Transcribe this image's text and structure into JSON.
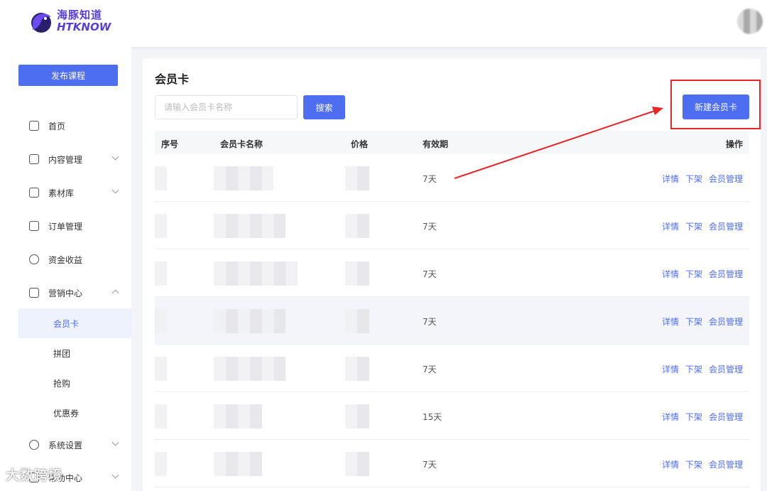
{
  "header": {
    "logo_cn": "海豚知道",
    "logo_en": "HTKNOW"
  },
  "sidebar": {
    "publish_label": "发布课程",
    "items": [
      {
        "label": "首页",
        "icon": "home-icon"
      },
      {
        "label": "内容管理",
        "icon": "content-icon"
      },
      {
        "label": "素材库",
        "icon": "folder-icon"
      },
      {
        "label": "订单管理",
        "icon": "order-icon"
      },
      {
        "label": "资金收益",
        "icon": "money-bag-icon"
      },
      {
        "label": "营销中心",
        "icon": "marketing-icon"
      },
      {
        "label": "会员卡"
      },
      {
        "label": "拼团"
      },
      {
        "label": "抢购"
      },
      {
        "label": "优惠券"
      },
      {
        "label": "系统设置",
        "icon": "settings-icon"
      },
      {
        "label": "帮助中心",
        "icon": "help-icon"
      }
    ]
  },
  "page": {
    "title": "会员卡",
    "search_placeholder": "请输入会员卡名称",
    "search_label": "搜索",
    "new_label": "新建会员卡"
  },
  "table": {
    "headers": [
      "序号",
      "会员卡名称",
      "价格",
      "有效期",
      "操作"
    ],
    "rows": [
      {
        "valid": "7天"
      },
      {
        "valid": "7天"
      },
      {
        "valid": "7天"
      },
      {
        "valid": "7天"
      },
      {
        "valid": "7天"
      },
      {
        "valid": "15天"
      },
      {
        "valid": "7天"
      }
    ],
    "ops": [
      "详情",
      "下架",
      "会员管理"
    ]
  },
  "watermark": "大数跨境",
  "colors": {
    "accent": "#4e6ef2",
    "annotation": "#e8262a"
  }
}
